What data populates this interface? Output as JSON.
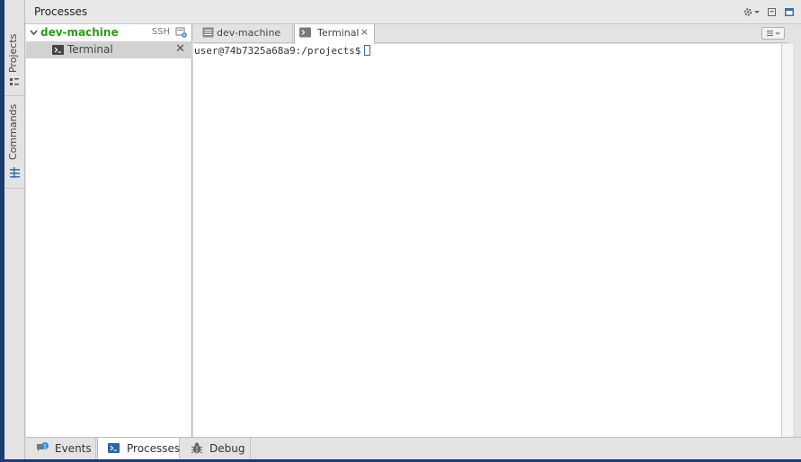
{
  "header": {
    "title": "Processes"
  },
  "side_tabs": [
    {
      "label": "Projects",
      "icon": "project-explorer-icon"
    },
    {
      "label": "Commands",
      "icon": "commands-icon"
    }
  ],
  "process_tree": {
    "machine": {
      "name": "dev-machine",
      "expanded": true,
      "connection_label": "SSH",
      "machine_icon": "add-process-icon"
    },
    "processes": [
      {
        "label": "Terminal",
        "icon": "terminal-icon",
        "selected": true
      }
    ]
  },
  "editor_tabs": [
    {
      "label": "dev-machine",
      "icon": "machine-info-icon",
      "active": false
    },
    {
      "label": "Terminal",
      "icon": "terminal-icon",
      "active": true,
      "close": "×"
    }
  ],
  "terminal": {
    "prompt": "user@74b7325a68a9:/projects$"
  },
  "bottom_tabs": [
    {
      "label": "Events",
      "icon": "events-icon",
      "badge": "1",
      "active": false
    },
    {
      "label": "Processes",
      "icon": "terminal-icon",
      "active": true
    },
    {
      "label": "Debug",
      "icon": "bug-icon",
      "active": false
    }
  ],
  "tree_close_glyph": "✕",
  "colors": {
    "machine_green": "#2a9c16",
    "frame_blue": "#1e3a6e",
    "cursor_blue": "#3b6ea8"
  }
}
